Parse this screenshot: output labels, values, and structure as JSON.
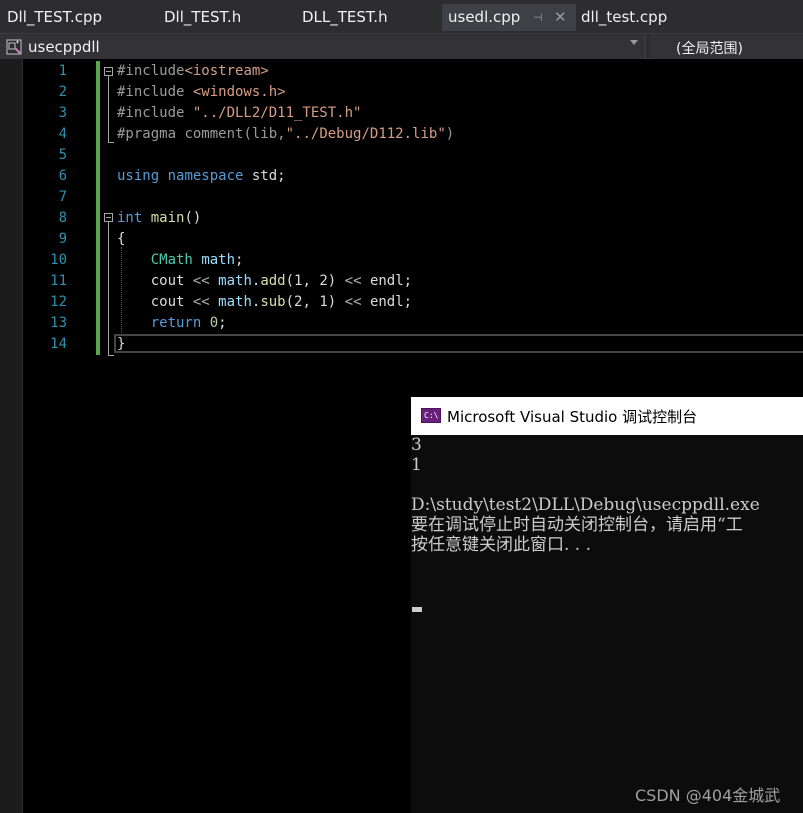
{
  "tabs": [
    {
      "label": "Dll_TEST.cpp",
      "active": false
    },
    {
      "label": "Dll_TEST.h",
      "active": false
    },
    {
      "label": "DLL_TEST.h",
      "active": false
    },
    {
      "label": "usedl.cpp",
      "active": true
    },
    {
      "label": "dll_test.cpp",
      "active": false
    }
  ],
  "tab_pin_glyph": "⊣",
  "tab_close_glyph": "✕",
  "navbar": {
    "project": "usecppdll",
    "scope": "(全局范围)"
  },
  "editor": {
    "line_numbers": [
      "1",
      "2",
      "3",
      "4",
      "5",
      "6",
      "7",
      "8",
      "9",
      "10",
      "11",
      "12",
      "13",
      "14"
    ],
    "lines": {
      "l1_pp": "#include",
      "l1_str": "<iostream>",
      "l2_pp": "#include ",
      "l2_str": "<windows.h>",
      "l3_pp": "#include ",
      "l3_str": "\"../DLL2/D11_TEST.h\"",
      "l4_pp": "#pragma ",
      "l4_kw": "comment",
      "l4_rest": "(lib,",
      "l4_str": "\"../Debug/D112.lib\"",
      "l4_end": ")",
      "l6_kw1": "using",
      "l6_kw2": "namespace",
      "l6_rest": " std;",
      "l8_kw": "int",
      "l8_fn": "main",
      "l8_rest": "()",
      "l9": "{",
      "l10_type": "CMath",
      "l10_var": "math",
      "l10_end": ";",
      "l11_cout": "cout",
      "l11_op1": "<<",
      "l11_var": "math",
      "l11_fn": "add",
      "l11_args": "(1, 2)",
      "l11_op2": "<<",
      "l11_endl": "endl",
      "l11_end": ";",
      "l12_cout": "cout",
      "l12_op1": "<<",
      "l12_var": "math",
      "l12_fn": "sub",
      "l12_args": "(2, 1)",
      "l12_op2": "<<",
      "l12_endl": "endl",
      "l12_end": ";",
      "l13_kw": "return",
      "l13_num": "0",
      "l13_end": ";",
      "l14": "}"
    }
  },
  "console": {
    "title": "Microsoft Visual Studio 调试控制台",
    "icon_label": "C:\\",
    "lines": [
      "3",
      "1",
      "",
      "D:\\study\\test2\\DLL\\Debug\\usecppdll.exe",
      "要在调试停止时自动关闭控制台，请启用“工",
      "按任意键关闭此窗口. . ."
    ]
  },
  "watermark": "CSDN @404金城武"
}
